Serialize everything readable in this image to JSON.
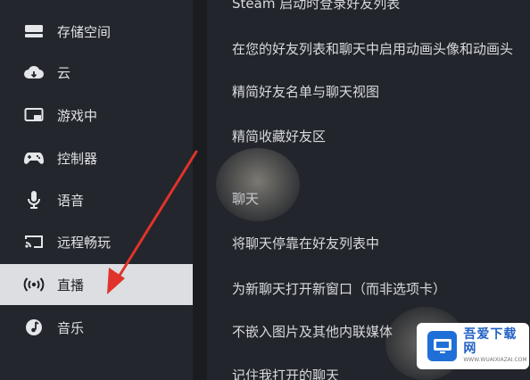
{
  "sidebar": {
    "items": [
      {
        "label": "存储空间",
        "icon": "storage-icon",
        "active": false
      },
      {
        "label": "云",
        "icon": "cloud-icon",
        "active": false
      },
      {
        "label": "游戏中",
        "icon": "in-game-icon",
        "active": false
      },
      {
        "label": "控制器",
        "icon": "controller-icon",
        "active": false
      },
      {
        "label": "语音",
        "icon": "microphone-icon",
        "active": false
      },
      {
        "label": "远程畅玩",
        "icon": "remote-play-icon",
        "active": false
      },
      {
        "label": "直播",
        "icon": "broadcast-icon",
        "active": true
      },
      {
        "label": "音乐",
        "icon": "music-icon",
        "active": false
      }
    ]
  },
  "main": {
    "partial_top": "Steam 启动时登录好友列表",
    "rows": [
      "在您的好友列表和聊天中启用动画头像和动画头",
      "精简好友名单与聊天视图",
      "精简收藏好友区"
    ],
    "section_title": "聊天",
    "chat_rows": [
      "将聊天停靠在好友列表中",
      "为新聊天打开新窗口（而非选项卡）",
      "不嵌入图片及其他内联媒体",
      "记住我打开的聊天"
    ]
  },
  "annotation": {
    "arrow_color": "#e0332b"
  },
  "watermark": {
    "name": "吾爱下载网",
    "url": "WWW.WUAIXIAZAI.COM"
  },
  "colors": {
    "sidebar_bg": "#23262c",
    "active_bg": "#dcdee1",
    "main_bg": "#22252b"
  }
}
